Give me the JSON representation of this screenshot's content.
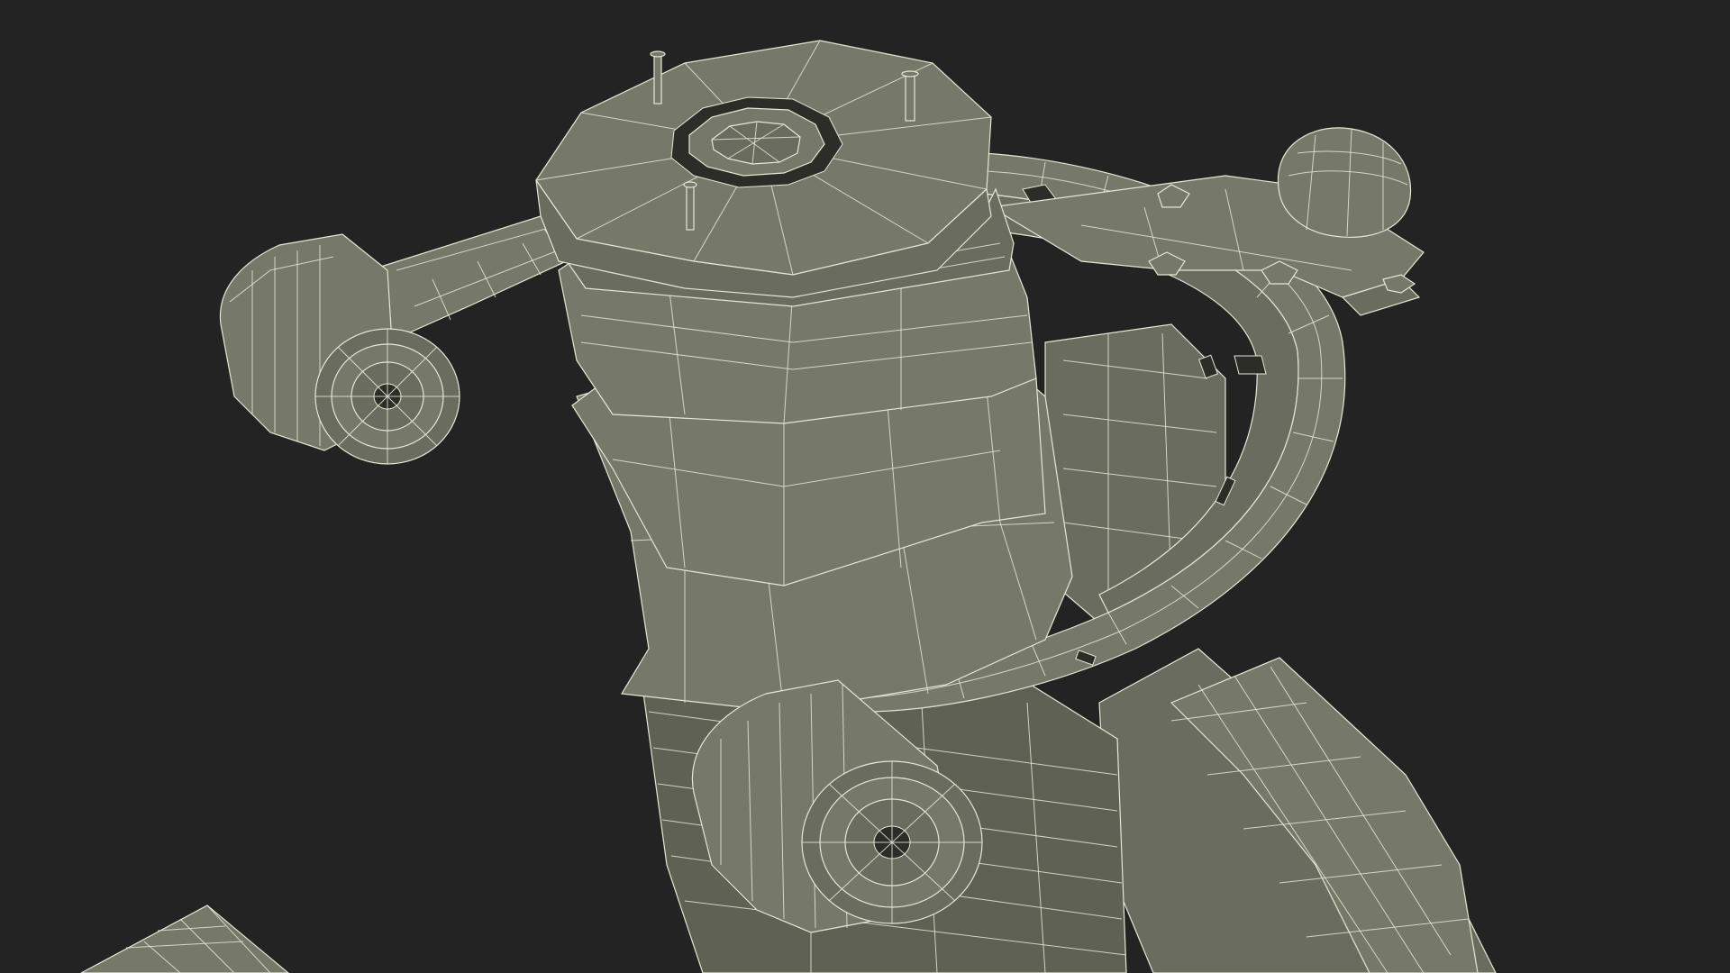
{
  "scene": {
    "background_color": "#232323",
    "model_fill_color": "#76786a",
    "wire_color": "#e6e6d2"
  }
}
